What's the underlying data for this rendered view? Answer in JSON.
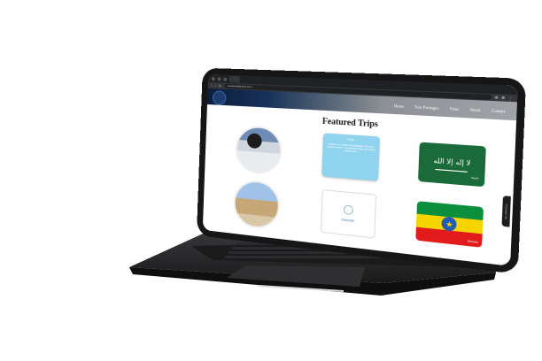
{
  "browser": {
    "tab_title": "",
    "url": "sweethalaltravel.com"
  },
  "site": {
    "nav": [
      "Home",
      "Tour Packages",
      "Visas",
      "About",
      "Contact"
    ],
    "heading": "Featured Trips",
    "cards": {
      "info_title": "Ihram",
      "info_body": "Explore our curated trip packages and enjoy seamless travel, comfortable hotels and guided experiences.",
      "blank_label": "Zamzam",
      "saudi_caption": "Saudi",
      "ethiopia_caption": "Ethiopia"
    },
    "side_tab": "Contact Us"
  },
  "colors": {
    "accent": "#8fd3ef",
    "saudi_green": "#1b6b3a",
    "header_dark": "#0d1d3a"
  }
}
